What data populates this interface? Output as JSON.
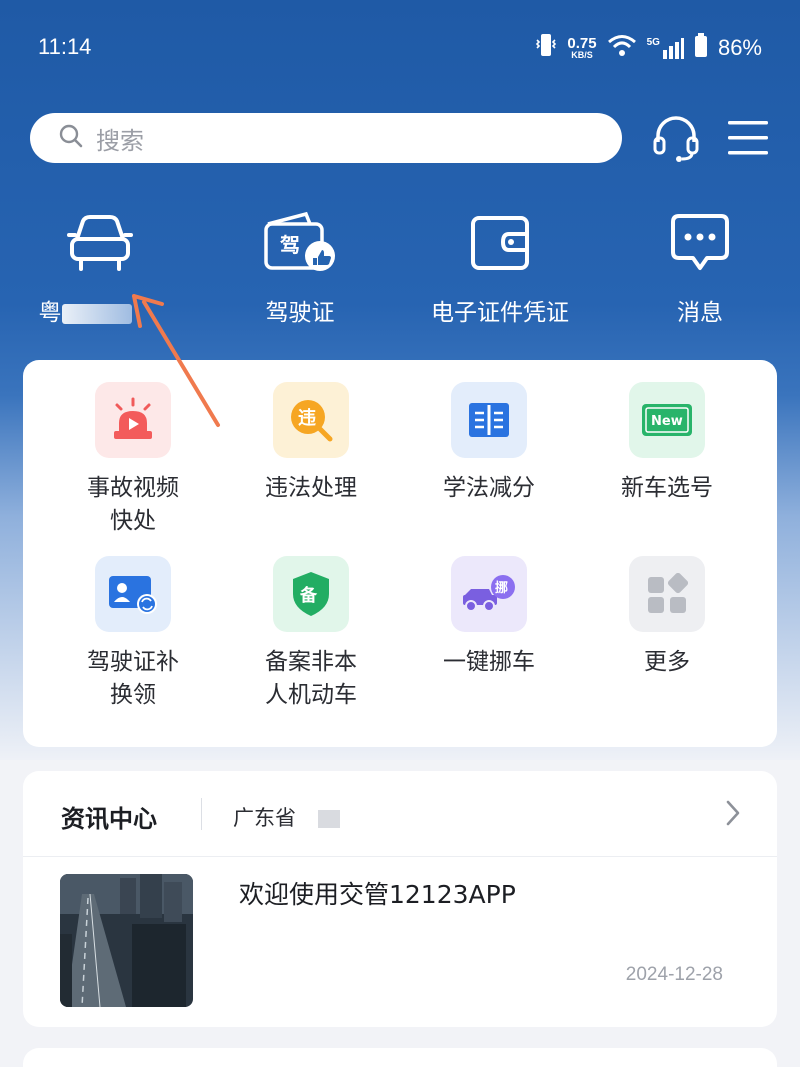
{
  "status_bar": {
    "time": "11:14",
    "net_speed_value": "0.75",
    "net_speed_unit": "KB/S",
    "network": "5G",
    "battery": "86%"
  },
  "search": {
    "placeholder": "搜索"
  },
  "header_icons": [
    "headset-icon",
    "menu-icon"
  ],
  "top_shortcuts": [
    {
      "icon": "car-icon",
      "label": "粤"
    },
    {
      "icon": "license-icon",
      "label": "驾驶证",
      "icon_text": "驾"
    },
    {
      "icon": "wallet-icon",
      "label": "电子证件凭证"
    },
    {
      "icon": "message-icon",
      "label": "消息"
    }
  ],
  "services": [
    {
      "icon": "alarm-light-icon",
      "label_line1": "事故视频",
      "label_line2": "快处",
      "tile_color": "#fde8e8"
    },
    {
      "icon": "violation-icon",
      "label_line1": "违法处理",
      "label_line2": "",
      "icon_text": "违",
      "tile_color": "#fdf1d6"
    },
    {
      "icon": "book-icon",
      "label_line1": "学法减分",
      "label_line2": "",
      "tile_color": "#e3edfb"
    },
    {
      "icon": "new-plate-icon",
      "label_line1": "新车选号",
      "label_line2": "",
      "icon_text": "New",
      "tile_color": "#e1f6ea"
    },
    {
      "icon": "license-renew-icon",
      "label_line1": "驾驶证补",
      "label_line2": "换领",
      "tile_color": "#e3edfb"
    },
    {
      "icon": "shield-icon",
      "label_line1": "备案非本",
      "label_line2": "人机动车",
      "icon_text": "备",
      "tile_color": "#e1f6ea"
    },
    {
      "icon": "tow-truck-icon",
      "label_line1": "一键挪车",
      "label_line2": "",
      "icon_text": "挪",
      "tile_color": "#ece8fb"
    },
    {
      "icon": "more-grid-icon",
      "label_line1": "更多",
      "label_line2": "",
      "tile_color": "#eeeff2"
    }
  ],
  "news": {
    "title": "资讯中心",
    "region": "广东省",
    "items": [
      {
        "headline": "欢迎使用交管12123APP",
        "date": "2024-12-28"
      }
    ]
  },
  "colors": {
    "header_blue": "#1f5aa6",
    "annotation_arrow": "#f07a4e"
  }
}
